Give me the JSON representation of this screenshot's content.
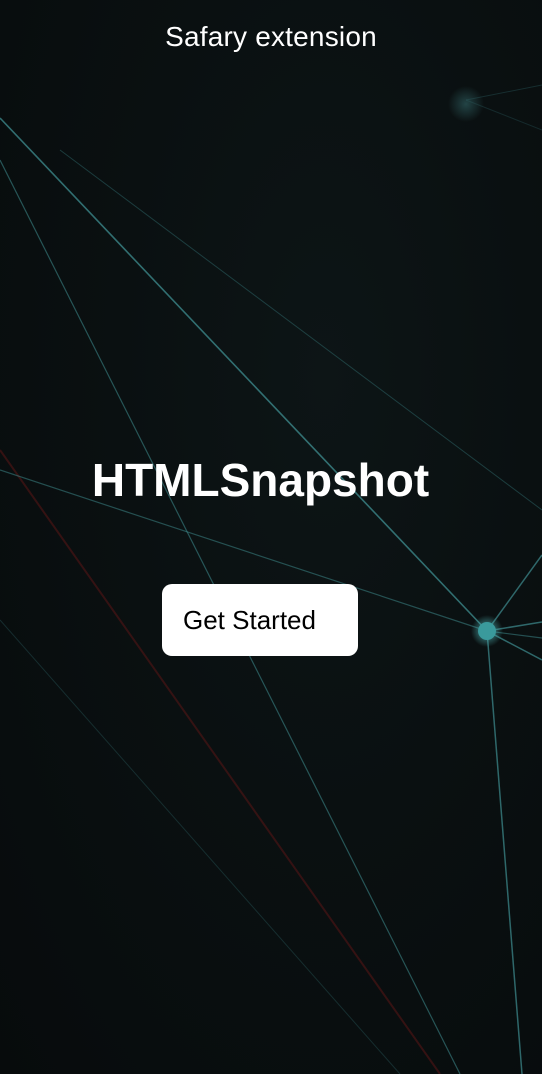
{
  "header": {
    "title": "Safary extension"
  },
  "hero": {
    "app_name": "HTMLSnapshot",
    "cta_label": "Get Started"
  },
  "theme": {
    "background": "#0a0f10",
    "network_line": "#3f8f92",
    "network_node": "#3a9a9c",
    "accent_red": "#6b1a1a",
    "button_bg": "#ffffff",
    "text": "#ffffff"
  }
}
